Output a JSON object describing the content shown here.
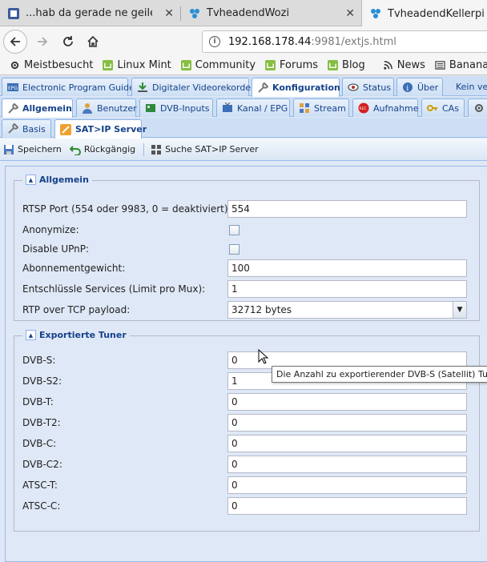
{
  "browser": {
    "tabs": [
      {
        "title": "...hab da gerade ne geile Idee",
        "active": false
      },
      {
        "title": "TvheadendWozi",
        "active": false
      },
      {
        "title": "TvheadendKellerpi",
        "active": true
      }
    ],
    "url": {
      "host": "192.168.178.44",
      "rest": ":9981/extjs.html"
    },
    "bookmarks": [
      "Meistbesucht",
      "Linux Mint",
      "Community",
      "Forums",
      "Blog",
      "News",
      "Bananaserver"
    ]
  },
  "tabs_main": [
    "Electronic Program Guide",
    "Digitaler Videorekorder",
    "Konfiguration",
    "Status",
    "Über",
    "Kein ve"
  ],
  "tabs_config": [
    "Allgemein",
    "Benutzer",
    "DVB-Inputs",
    "Kanal / EPG",
    "Stream",
    "Aufnahme",
    "CAs"
  ],
  "tabs_general": [
    "Basis",
    "SAT>IP Server"
  ],
  "toolbar": {
    "save": "Speichern",
    "undo": "Rückgängig",
    "search": "Suche SAT>IP Server"
  },
  "fieldset_general": {
    "legend": "Allgemein",
    "rtsp_label": "RTSP Port (554 oder 9983, 0 = deaktiviert):",
    "rtsp_value": "554",
    "anonymize_label": "Anonymize:",
    "upnp_label": "Disable UPnP:",
    "weight_label": "Abonnementgewicht:",
    "weight_value": "100",
    "descramble_label": "Entschlüssle Services (Limit pro Mux):",
    "descramble_value": "1",
    "rtp_label": "RTP over TCP payload:",
    "rtp_value": "32712 bytes"
  },
  "fieldset_tuners": {
    "legend": "Exportierte Tuner",
    "rows": [
      {
        "label": "DVB-S:",
        "value": "0"
      },
      {
        "label": "DVB-S2:",
        "value": "1"
      },
      {
        "label": "DVB-T:",
        "value": "0"
      },
      {
        "label": "DVB-T2:",
        "value": "0"
      },
      {
        "label": "DVB-C:",
        "value": "0"
      },
      {
        "label": "DVB-C2:",
        "value": "0"
      },
      {
        "label": "ATSC-T:",
        "value": "0"
      },
      {
        "label": "ATSC-C:",
        "value": "0"
      }
    ]
  },
  "tooltip": "Die Anzahl zu exportierender DVB-S (Satellit) Tuner."
}
